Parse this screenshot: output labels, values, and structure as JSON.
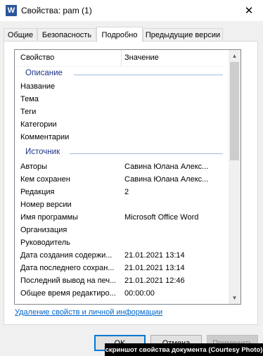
{
  "window": {
    "title": "Свойства: pam (1)",
    "app_icon": "W",
    "close_glyph": "✕"
  },
  "tabs": [
    {
      "label": "Общие",
      "active": false
    },
    {
      "label": "Безопасность",
      "active": false
    },
    {
      "label": "Подробно",
      "active": true
    },
    {
      "label": "Предыдущие версии",
      "active": false
    }
  ],
  "list": {
    "columns": {
      "property": "Свойство",
      "value": "Значение"
    },
    "groups": {
      "description": "Описание",
      "source": "Источник"
    },
    "description_rows": [
      {
        "key": "Название",
        "value": ""
      },
      {
        "key": "Тема",
        "value": ""
      },
      {
        "key": "Теги",
        "value": ""
      },
      {
        "key": "Категории",
        "value": ""
      },
      {
        "key": "Комментарии",
        "value": ""
      }
    ],
    "source_rows": [
      {
        "key": "Авторы",
        "value": "Савина Юлана Алекс..."
      },
      {
        "key": "Кем сохранен",
        "value": "Савина Юлана Алекс..."
      },
      {
        "key": "Редакция",
        "value": "2"
      },
      {
        "key": "Номер версии",
        "value": ""
      },
      {
        "key": "Имя программы",
        "value": "Microsoft Office Word"
      },
      {
        "key": "Организация",
        "value": ""
      },
      {
        "key": "Руководитель",
        "value": ""
      },
      {
        "key": "Дата создания содержи...",
        "value": "21.01.2021 13:14"
      },
      {
        "key": "Дата последнего сохран...",
        "value": "21.01.2021 13:14"
      },
      {
        "key": "Последний вывод на печ...",
        "value": "21.01.2021 12:46"
      },
      {
        "key": "Общее время редактиро...",
        "value": "00:00:00"
      }
    ]
  },
  "remove_link": "Удаление свойств и личной информации",
  "buttons": {
    "ok": "OK",
    "cancel": "Отмена",
    "apply": "Применить"
  },
  "caption": "скриншот свойства документа (Courtesy Photo)",
  "colors": {
    "group_label": "#1e3287",
    "link": "#0066cc",
    "ok_border": "#0078d7"
  }
}
